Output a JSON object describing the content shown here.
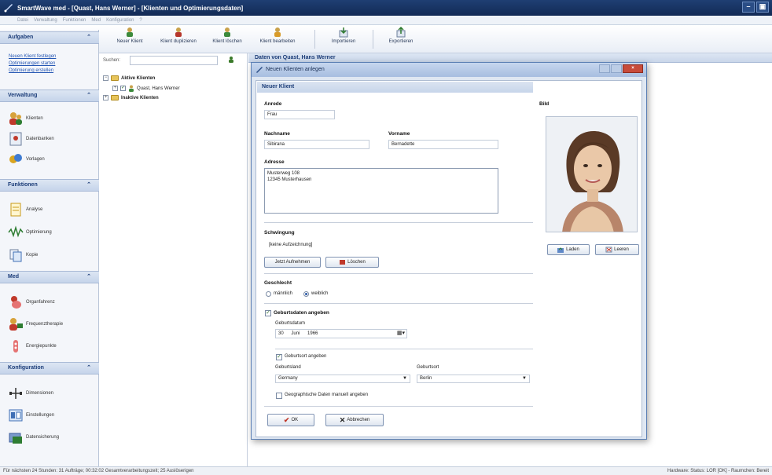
{
  "window": {
    "title": "SmartWave med - [Quast, Hans Werner] - [Klienten und Optimierungsdaten]",
    "minimize": "–",
    "maximize": "▣"
  },
  "menu": {
    "items": [
      "Datei",
      "Verwaltung",
      "Funktionen",
      "Med",
      "Konfiguration",
      "?"
    ]
  },
  "toolbar": {
    "buttons": [
      {
        "label": "Neuer Klient",
        "icon": "person-add-icon"
      },
      {
        "label": "Klient duplizieren",
        "icon": "person-duplicate-icon"
      },
      {
        "label": "Klient löschen",
        "icon": "person-delete-icon"
      },
      {
        "label": "Klient bearbeiten",
        "icon": "person-edit-icon"
      },
      {
        "label": "Importieren",
        "icon": "import-icon"
      },
      {
        "label": "Exportieren",
        "icon": "export-icon"
      }
    ]
  },
  "nav": {
    "sections": {
      "aufgaben": "Aufgaben",
      "verwaltung": "Verwaltung",
      "funktionen": "Funktionen",
      "med": "Med",
      "konfiguration": "Konfiguration"
    },
    "chevron": "⌃",
    "links": [
      "Neuen Klient festlegen",
      "Optimierungen starten",
      "Optimierung erstellen"
    ],
    "verwaltung_items": [
      "Klienten",
      "Datenbanken",
      "Vorlagen"
    ],
    "funktionen_items": [
      "Analyse",
      "Optimierung",
      "Kopie"
    ],
    "med_items": [
      "Organfahrenz",
      "Frequenztherapie",
      "Energiepunkte"
    ],
    "konfiguration_items": [
      "Dimensionen",
      "Einstellungen",
      "Datensicherung"
    ]
  },
  "list": {
    "search_label": "Suchen:",
    "search_value": "",
    "tree": {
      "active": "Aktive Klienten",
      "client": "Quast, Hans Werner",
      "inactive": "Inaktive Klienten"
    }
  },
  "content": {
    "header": "Daten von Quast, Hans Werner"
  },
  "dialog": {
    "title": "Neuen Klienten anlegen",
    "section_title": "Neuer Klient",
    "anrede_label": "Anrede",
    "anrede_value": "Frau",
    "nachname_label": "Nachname",
    "nachname_value": "Sibirana",
    "vorname_label": "Vorname",
    "vorname_value": "Bernadette",
    "adresse_label": "Adresse",
    "adresse_value": "Musterweg 108\n12345 Musterhausen",
    "bild_label": "Bild",
    "laden_button": "Laden",
    "leeren_button": "Leeren",
    "schwingung_label": "Schwingung",
    "schwingung_value": "[keine Aufzeichnung]",
    "aufnehmen_button": "Jetzt Aufnehmen",
    "loeschen_button": "Löschen",
    "geschlecht_label": "Geschlecht",
    "maennlich": "männlich",
    "weiblich": "weiblich",
    "geschlecht_selected": "weiblich",
    "geburtsdaten_label": "Geburtsdaten angeben",
    "geburtsdatum_label": "Geburtsdatum",
    "geb_day": "30",
    "geb_month": "Juni",
    "geb_year": "1966",
    "geburtsort_check_label": "Geburtsort angeben",
    "geburtsland_label": "Geburtsland",
    "geburtsland_value": "Germany",
    "geburtsort_label": "Geburtsort",
    "geburtsort_value": "Berlin",
    "geo_check_label": "Geographische Daten manuell angeben",
    "ok_button": "OK",
    "abbrechen_button": "Abbrechen"
  },
  "status": {
    "left": "Für nächsten 24 Stunden: 31 Aufträge; 00:32:02 Gesamtverarbeitungszeit; 25 Auslöserigen",
    "right": "Hardware: Status: LOR [OK] - Raumchen: Bereit"
  }
}
